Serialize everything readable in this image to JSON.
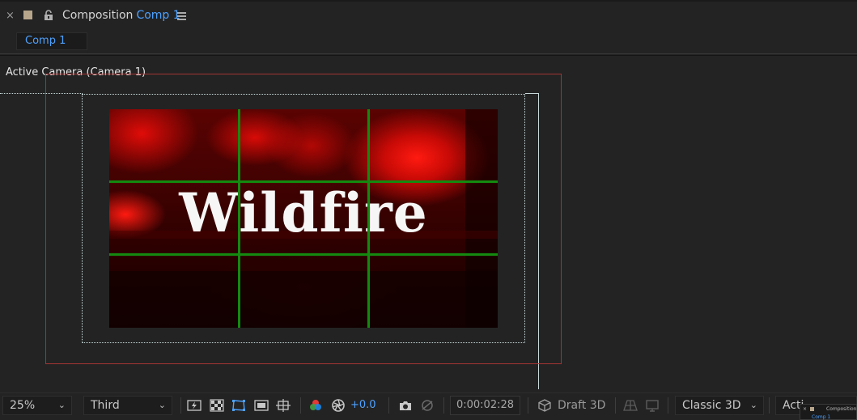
{
  "header": {
    "close_glyph": "×",
    "panel_label": "Composition",
    "comp_name": "Comp 1",
    "label_color": "#b8a68c",
    "accent_color": "#4ea1ff"
  },
  "tabs": [
    {
      "label": "Comp 1",
      "active": true
    }
  ],
  "viewer": {
    "camera_label": "Active Camera (Camera 1)",
    "title_text": "Wildfire",
    "grid": "rule of thirds",
    "grid_color": "#148a10",
    "action_safe_color": "#a33333",
    "title_safe_color": "#c8d8d8"
  },
  "toolbar": {
    "zoom": "25%",
    "resolution": "Third",
    "exposure": "+0.0",
    "timecode": "0:00:02:28",
    "draft": "Draft 3D",
    "renderer": "Classic 3D",
    "camera_view": "Acti",
    "icons": [
      "fast-previews-icon",
      "transparency-grid-icon",
      "mask-visibility-icon",
      "region-of-interest-icon",
      "grid-guides-icon",
      "color-channels-icon",
      "reset-exposure-icon",
      "snapshot-icon",
      "show-snapshot-icon",
      "draft-3d-icon",
      "ground-plane-icon",
      "extended-viewer-icon"
    ]
  },
  "mini_panel": {
    "label": "Composition",
    "comp": "Comp 1"
  }
}
